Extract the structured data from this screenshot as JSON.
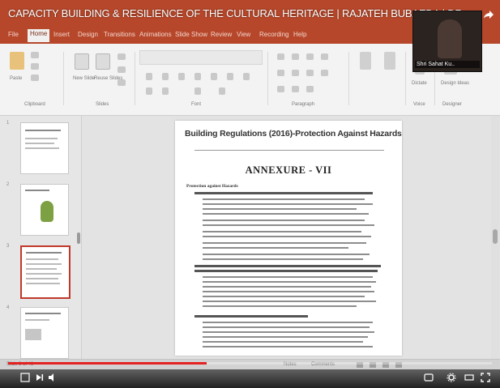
{
  "video": {
    "title": "CAPACITY BUILDING & RESILIENCE OF THE CULTURAL HERITAGE | RAJATEH BUBAEDA | DR. UMANG DAS",
    "presenter_name": "Shri Sahat Ku..",
    "current_time": "",
    "progress_fraction": 0.41,
    "watermark": "",
    "colors": {
      "progress": "#e52222",
      "titlebar": "#b7472a"
    }
  },
  "menu": {
    "items": [
      "File",
      "Home",
      "Insert",
      "Design",
      "Transitions",
      "Animations",
      "Slide Show",
      "Review",
      "View",
      "Recording",
      "Help"
    ]
  },
  "ribbon": {
    "groups": [
      "Clipboard",
      "Slides",
      "Font",
      "Paragraph",
      "Voice",
      "Designer"
    ],
    "paste_label": "Paste",
    "new_slide_label": "New Slide",
    "reuse_label": "Reuse Slides",
    "dictate_label": "Dictate",
    "designer_label": "Design Ideas"
  },
  "slides": {
    "numbers": [
      "1",
      "2",
      "3",
      "4"
    ],
    "selected_index": 2
  },
  "slide": {
    "heading": "Building Regulations (2016)-Protection Against Hazards",
    "annexure": "ANNEXURE - VII",
    "subtitle": "Protection against Hazards"
  },
  "status": {
    "slide_info": "Slide 3 of 48",
    "notes": "Notes",
    "comments": "Comments"
  },
  "icons": [
    "share-icon",
    "play-icon",
    "next-icon",
    "volume-icon",
    "settings-icon",
    "fullscreen-icon",
    "subtitles-icon"
  ]
}
